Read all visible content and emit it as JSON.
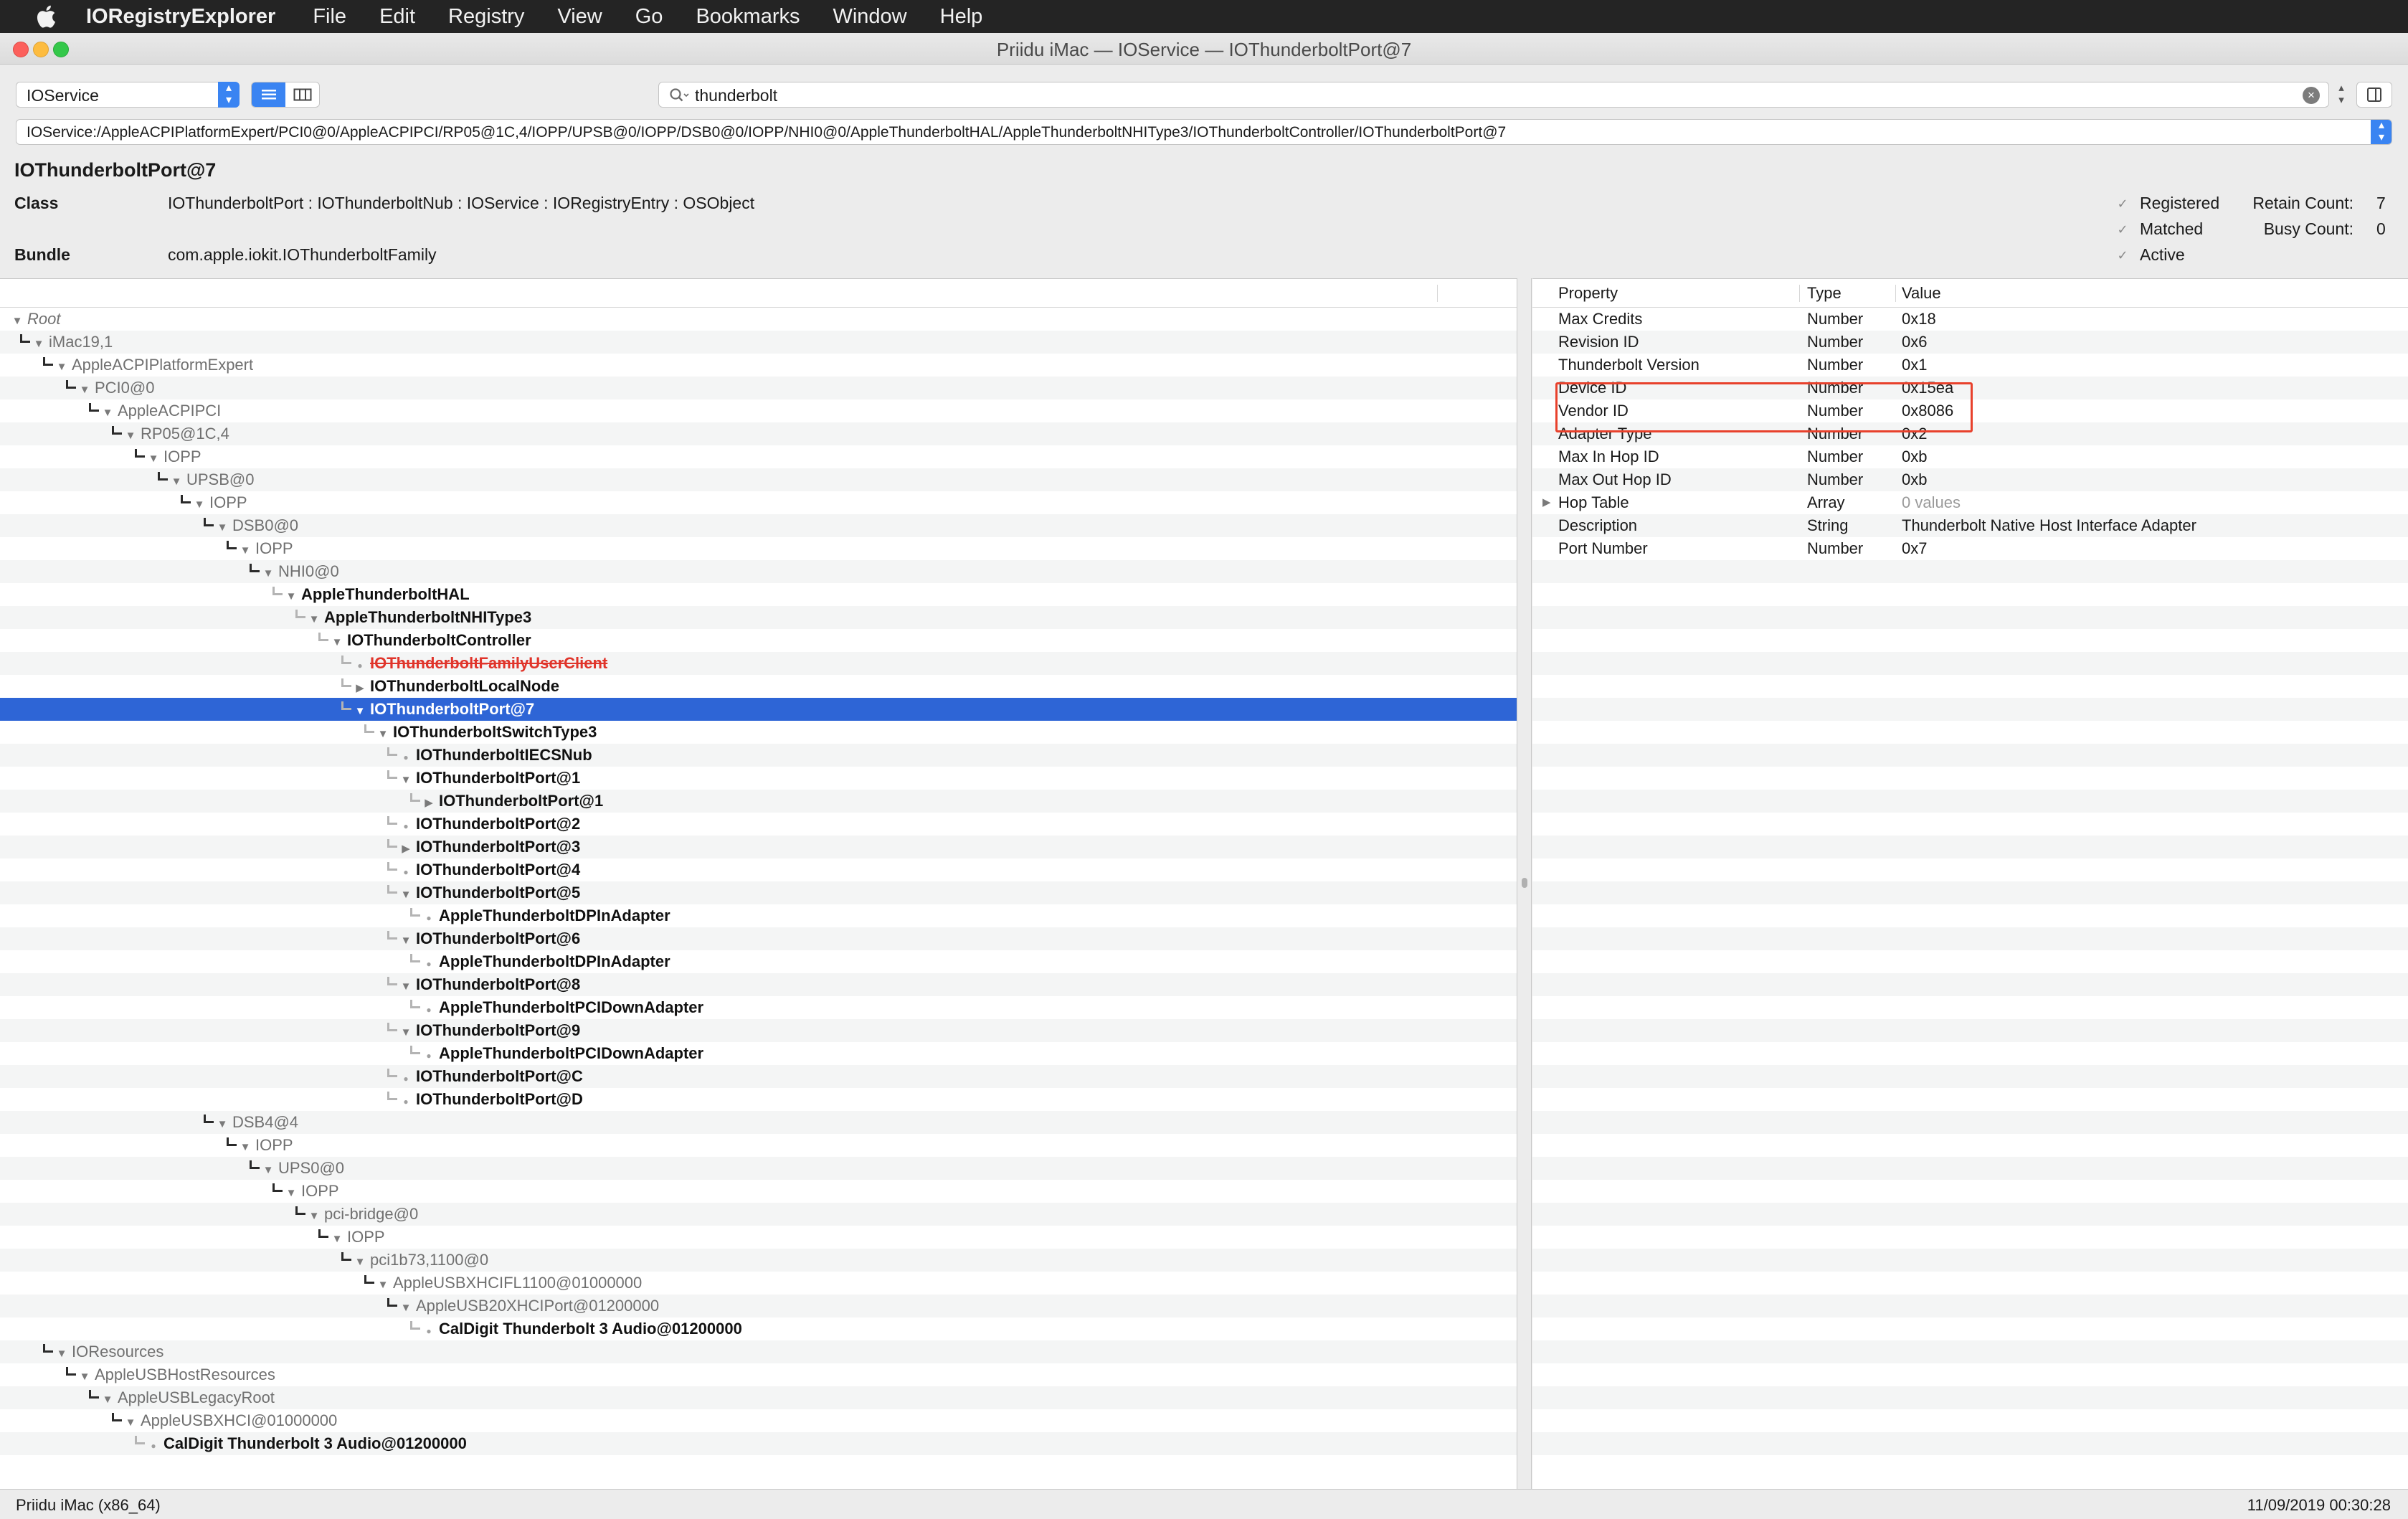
{
  "menubar": {
    "app": "IORegistryExplorer",
    "items": [
      "File",
      "Edit",
      "Registry",
      "View",
      "Go",
      "Bookmarks",
      "Window",
      "Help"
    ]
  },
  "window": {
    "title": "Priidu iMac — IOService — IOThunderboltPort@7"
  },
  "toolbar": {
    "plane": "IOService",
    "search_value": "thunderbolt",
    "path": "IOService:/AppleACPIPlatformExpert/PCI0@0/AppleACPIPCI/RP05@1C,4/IOPP/UPSB@0/IOPP/DSB0@0/IOPP/NHI0@0/AppleThunderboltHAL/AppleThunderboltNHIType3/IOThunderboltController/IOThunderboltPort@7"
  },
  "info": {
    "title": "IOThunderboltPort@7",
    "class_label": "Class",
    "class_value": "IOThunderboltPort : IOThunderboltNub : IOService : IORegistryEntry : OSObject",
    "bundle_label": "Bundle",
    "bundle_value": "com.apple.iokit.IOThunderboltFamily",
    "flags": [
      "Registered",
      "Matched",
      "Active"
    ],
    "retain_label": "Retain Count:",
    "retain_value": "7",
    "busy_label": "Busy Count:",
    "busy_value": "0"
  },
  "tree": [
    {
      "name": "Root",
      "depth": 0,
      "toggle": "open",
      "style": "italic"
    },
    {
      "name": "iMac19,1",
      "depth": 1,
      "toggle": "open",
      "style": "gray"
    },
    {
      "name": "AppleACPIPlatformExpert",
      "depth": 2,
      "toggle": "open",
      "style": "gray"
    },
    {
      "name": "PCI0@0",
      "depth": 3,
      "toggle": "open",
      "style": "gray"
    },
    {
      "name": "AppleACPIPCI",
      "depth": 4,
      "toggle": "open",
      "style": "gray"
    },
    {
      "name": "RP05@1C,4",
      "depth": 5,
      "toggle": "open",
      "style": "gray"
    },
    {
      "name": "IOPP",
      "depth": 6,
      "toggle": "open",
      "style": "gray"
    },
    {
      "name": "UPSB@0",
      "depth": 7,
      "toggle": "open",
      "style": "gray"
    },
    {
      "name": "IOPP",
      "depth": 8,
      "toggle": "open",
      "style": "gray"
    },
    {
      "name": "DSB0@0",
      "depth": 9,
      "toggle": "open",
      "style": "gray"
    },
    {
      "name": "IOPP",
      "depth": 10,
      "toggle": "open",
      "style": "gray"
    },
    {
      "name": "NHI0@0",
      "depth": 11,
      "toggle": "open",
      "style": "gray"
    },
    {
      "name": "AppleThunderboltHAL",
      "depth": 12,
      "toggle": "open",
      "style": "bold"
    },
    {
      "name": "AppleThunderboltNHIType3",
      "depth": 13,
      "toggle": "open",
      "style": "bold"
    },
    {
      "name": "IOThunderboltController",
      "depth": 14,
      "toggle": "open",
      "style": "bold"
    },
    {
      "name": "IOThunderboltFamilyUserClient",
      "depth": 15,
      "toggle": "leaf",
      "style": "red"
    },
    {
      "name": "IOThunderboltLocalNode",
      "depth": 15,
      "toggle": "closed",
      "style": "bold"
    },
    {
      "name": "IOThunderboltPort@7",
      "depth": 15,
      "toggle": "open",
      "style": "bold",
      "selected": true
    },
    {
      "name": "IOThunderboltSwitchType3",
      "depth": 16,
      "toggle": "open",
      "style": "bold"
    },
    {
      "name": "IOThunderboltIECSNub",
      "depth": 17,
      "toggle": "leaf",
      "style": "bold"
    },
    {
      "name": "IOThunderboltPort@1",
      "depth": 17,
      "toggle": "open",
      "style": "bold"
    },
    {
      "name": "IOThunderboltPort@1",
      "depth": 18,
      "toggle": "closed",
      "style": "bold"
    },
    {
      "name": "IOThunderboltPort@2",
      "depth": 17,
      "toggle": "leaf",
      "style": "bold"
    },
    {
      "name": "IOThunderboltPort@3",
      "depth": 17,
      "toggle": "closed",
      "style": "bold"
    },
    {
      "name": "IOThunderboltPort@4",
      "depth": 17,
      "toggle": "leaf",
      "style": "bold"
    },
    {
      "name": "IOThunderboltPort@5",
      "depth": 17,
      "toggle": "open",
      "style": "bold"
    },
    {
      "name": "AppleThunderboltDPInAdapter",
      "depth": 18,
      "toggle": "leaf",
      "style": "bold"
    },
    {
      "name": "IOThunderboltPort@6",
      "depth": 17,
      "toggle": "open",
      "style": "bold"
    },
    {
      "name": "AppleThunderboltDPInAdapter",
      "depth": 18,
      "toggle": "leaf",
      "style": "bold"
    },
    {
      "name": "IOThunderboltPort@8",
      "depth": 17,
      "toggle": "open",
      "style": "bold"
    },
    {
      "name": "AppleThunderboltPCIDownAdapter",
      "depth": 18,
      "toggle": "leaf",
      "style": "bold"
    },
    {
      "name": "IOThunderboltPort@9",
      "depth": 17,
      "toggle": "open",
      "style": "bold"
    },
    {
      "name": "AppleThunderboltPCIDownAdapter",
      "depth": 18,
      "toggle": "leaf",
      "style": "bold"
    },
    {
      "name": "IOThunderboltPort@C",
      "depth": 17,
      "toggle": "leaf",
      "style": "bold"
    },
    {
      "name": "IOThunderboltPort@D",
      "depth": 17,
      "toggle": "leaf",
      "style": "bold"
    },
    {
      "name": "DSB4@4",
      "depth": 9,
      "toggle": "open",
      "style": "gray"
    },
    {
      "name": "IOPP",
      "depth": 10,
      "toggle": "open",
      "style": "gray"
    },
    {
      "name": "UPS0@0",
      "depth": 11,
      "toggle": "open",
      "style": "gray"
    },
    {
      "name": "IOPP",
      "depth": 12,
      "toggle": "open",
      "style": "gray"
    },
    {
      "name": "pci-bridge@0",
      "depth": 13,
      "toggle": "open",
      "style": "gray"
    },
    {
      "name": "IOPP",
      "depth": 14,
      "toggle": "open",
      "style": "gray"
    },
    {
      "name": "pci1b73,1100@0",
      "depth": 15,
      "toggle": "open",
      "style": "gray"
    },
    {
      "name": "AppleUSBXHCIFL1100@01000000",
      "depth": 16,
      "toggle": "open",
      "style": "gray"
    },
    {
      "name": "AppleUSB20XHCIPort@01200000",
      "depth": 17,
      "toggle": "open",
      "style": "gray"
    },
    {
      "name": "CalDigit Thunderbolt 3 Audio@01200000",
      "depth": 18,
      "toggle": "leaf",
      "style": "bold"
    },
    {
      "name": "IOResources",
      "depth": 2,
      "toggle": "open",
      "style": "gray"
    },
    {
      "name": "AppleUSBHostResources",
      "depth": 3,
      "toggle": "open",
      "style": "gray"
    },
    {
      "name": "AppleUSBLegacyRoot",
      "depth": 4,
      "toggle": "open",
      "style": "gray"
    },
    {
      "name": "AppleUSBXHCI@01000000",
      "depth": 5,
      "toggle": "open",
      "style": "gray"
    },
    {
      "name": "CalDigit Thunderbolt 3 Audio@01200000",
      "depth": 6,
      "toggle": "leaf",
      "style": "bold"
    }
  ],
  "properties": {
    "headers": [
      "Property",
      "Type",
      "Value"
    ],
    "rows": [
      {
        "name": "Max Credits",
        "type": "Number",
        "value": "0x18"
      },
      {
        "name": "Revision ID",
        "type": "Number",
        "value": "0x6"
      },
      {
        "name": "Thunderbolt Version",
        "type": "Number",
        "value": "0x1"
      },
      {
        "name": "Device ID",
        "type": "Number",
        "value": "0x15ea",
        "highlight": true
      },
      {
        "name": "Vendor ID",
        "type": "Number",
        "value": "0x8086",
        "highlight": true
      },
      {
        "name": "Adapter Type",
        "type": "Number",
        "value": "0x2"
      },
      {
        "name": "Max In Hop ID",
        "type": "Number",
        "value": "0xb"
      },
      {
        "name": "Max Out Hop ID",
        "type": "Number",
        "value": "0xb"
      },
      {
        "name": "Hop Table",
        "type": "Array",
        "value": "0 values",
        "expandable": true,
        "muted": true
      },
      {
        "name": "Description",
        "type": "String",
        "value": "Thunderbolt Native Host Interface Adapter"
      },
      {
        "name": "Port Number",
        "type": "Number",
        "value": "0x7"
      }
    ]
  },
  "status": {
    "left": "Priidu iMac (x86_64)",
    "right": "11/09/2019 00:30:28"
  },
  "colors": {
    "selection": "#2e65d6",
    "accent": "#3a84f2",
    "highlight_box": "#e8412c",
    "terminated": "#e0342a"
  }
}
